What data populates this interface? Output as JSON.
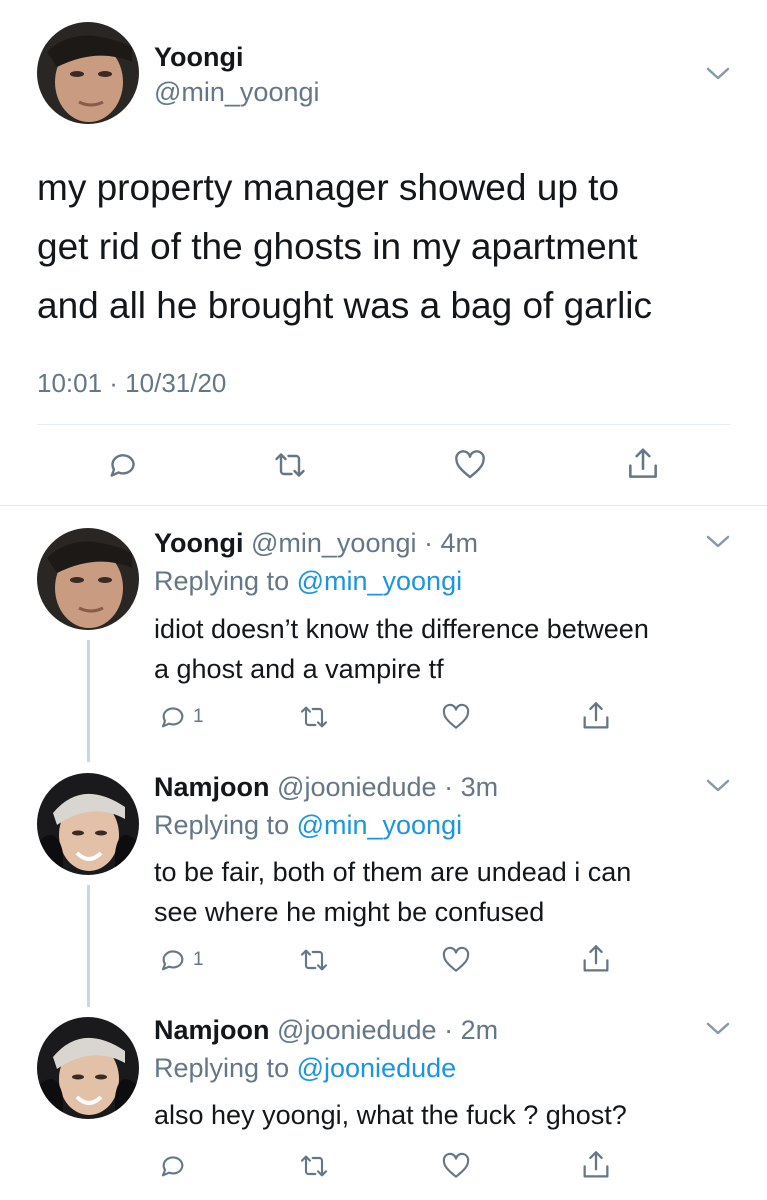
{
  "main_tweet": {
    "name": "Yoongi",
    "handle": "@min_yoongi",
    "lines": [
      "my property manager showed up to",
      "get rid of the ghosts in my apartment",
      "and all he brought was a bag of garlic"
    ],
    "timestamp": "10:01 · 10/31/20",
    "icons": [
      "reply-icon",
      "retweet-icon",
      "like-icon",
      "share-icon"
    ]
  },
  "replies": [
    {
      "name": "Yoongi",
      "handle": "@min_yoongi",
      "time": "· 4m",
      "replying_prefix": "Replying to ",
      "replying_to": "@min_yoongi",
      "lines": [
        "idiot doesn’t know the difference between",
        "a ghost and a vampire tf"
      ],
      "reply_count": "1"
    },
    {
      "name": "Namjoon",
      "handle": "@jooniedude",
      "time": "· 3m",
      "replying_prefix": "Replying to ",
      "replying_to": "@min_yoongi",
      "lines": [
        "to be fair, both of them are undead i can",
        "see where he might be confused"
      ],
      "reply_count": "1"
    },
    {
      "name": "Namjoon",
      "handle": "@jooniedude",
      "time": "· 2m",
      "replying_prefix": "Replying to ",
      "replying_to": "@jooniedude",
      "lines": [
        "also hey yoongi, what the fuck ? ghost?"
      ],
      "reply_count": ""
    }
  ],
  "colors": {
    "link": "#1b95e0",
    "secondary_text": "#657786",
    "divider": "#e6ecf0",
    "thread_line": "#ccd6dd"
  }
}
